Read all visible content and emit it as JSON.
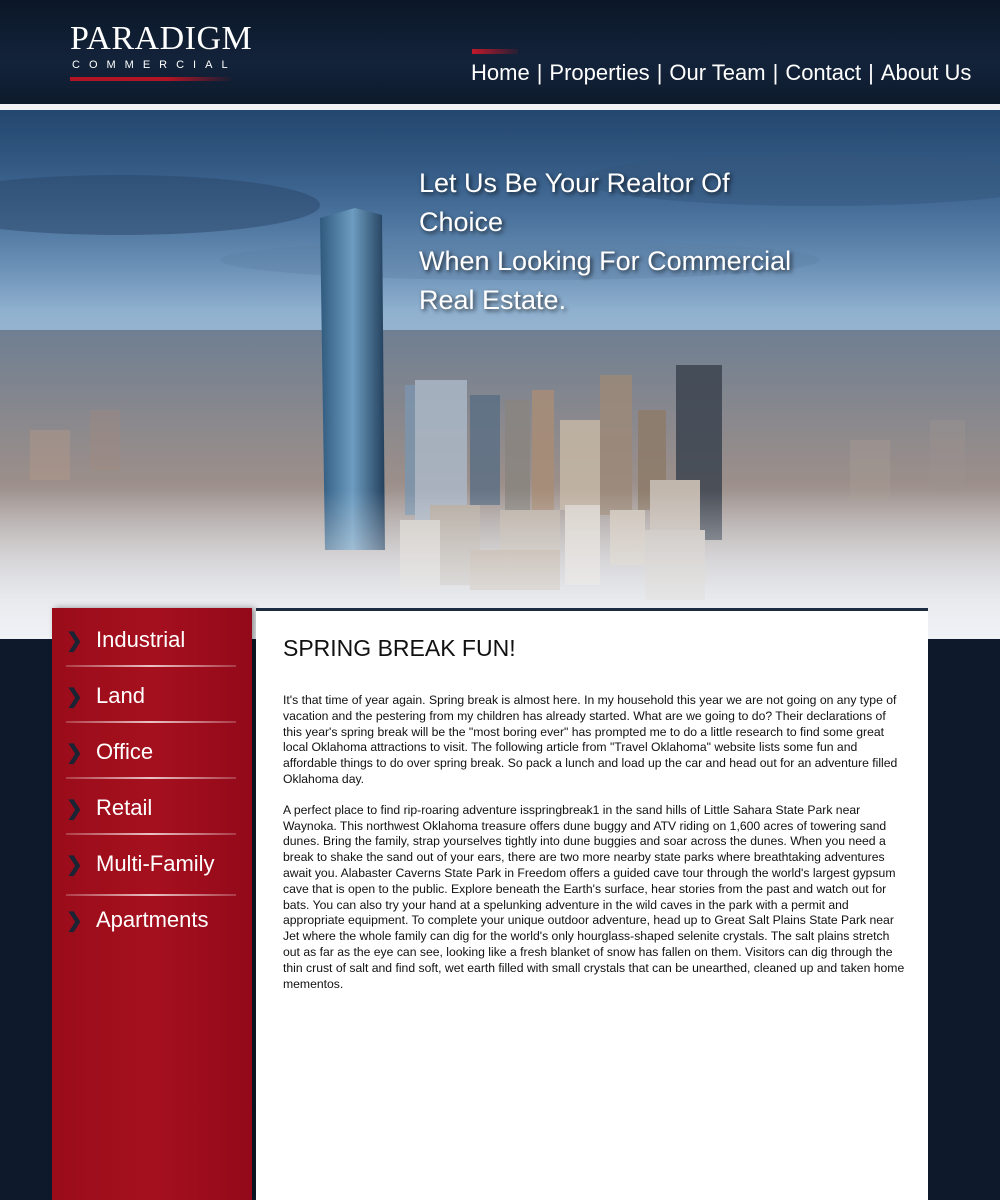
{
  "logo": {
    "main": "PARADIGM",
    "sub": "COMMERCIAL"
  },
  "nav": {
    "items": [
      "Home",
      "Properties",
      "Our Team",
      "Contact",
      "About Us"
    ],
    "separator": "|"
  },
  "hero": {
    "tagline_lines": [
      "Let Us Be Your Realtor Of Choice",
      "When Looking For Commercial",
      "Real Estate."
    ]
  },
  "sidebar": {
    "items": [
      "Industrial",
      "Land",
      "Office",
      "Retail",
      "Multi-Family",
      "Apartments"
    ],
    "chevron": "❯"
  },
  "article": {
    "title": "SPRING BREAK FUN!",
    "paragraphs": [
      "It's that time of year again. Spring break is almost here.  In my household this year we are not going on any type of vacation and the pestering from my children has already started. What are we going to do?   Their declarations of this year's spring break will be the \"most boring ever\" has prompted me to do a little research to find some great local Oklahoma attractions to visit.  The following article from \"Travel Oklahoma\" website lists some fun and affordable things to do over spring break.   So pack a lunch and load up the car and head out for an adventure filled Oklahoma day.",
      "A perfect place to find rip-roaring adventure isspringbreak1 in the sand hills of Little Sahara State Park near Waynoka. This northwest Oklahoma treasure offers dune buggy and ATV riding on 1,600 acres of towering sand dunes.  Bring the family, strap yourselves tightly into dune buggies and soar across the dunes.  When you need a break to shake the sand out of your ears, there are two more nearby state parks where breathtaking adventures await you.  Alabaster Caverns State Park in Freedom offers a guided cave tour through the world's largest gypsum cave that is open to the public.  Explore beneath the Earth's surface, hear stories from the past and watch out for bats.  You can also try your hand at a spelunking adventure in the wild caves in the park with a permit and appropriate equipment.  To complete your unique outdoor adventure, head up to Great Salt Plains State Park near Jet where the whole family can dig for the world's only hourglass-shaped selenite crystals.  The salt plains stretch out as far as the eye can see, looking like a fresh blanket of snow has fallen on them.  Visitors can dig through the thin crust of salt and find soft, wet earth filled with small crystals that can be unearthed, cleaned up and taken home mementos."
    ]
  },
  "colors": {
    "navy": "#0e1a2b",
    "red": "#a5101e",
    "white": "#ffffff"
  }
}
